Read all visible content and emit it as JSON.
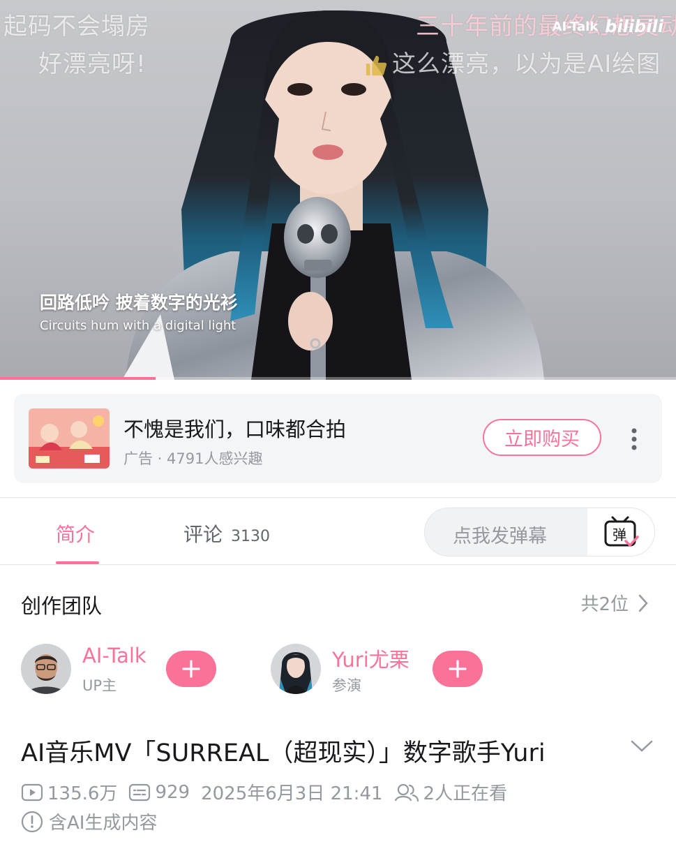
{
  "video": {
    "danmaku": [
      "起码不会塌房",
      "好漂亮呀!",
      "三十年前的最终幻想灵动",
      "这么漂亮，以为是AI绘图"
    ],
    "watermark_channel": "AI-Talk",
    "watermark_logo": "bilibili",
    "subtitle_cn": "回路低吟 披着数字的光衫",
    "subtitle_en": "Circuits hum with a digital light",
    "progress_fraction": 0.23
  },
  "ad": {
    "title": "不愧是我们，口味都合拍",
    "meta": "广告 · 4791人感兴趣",
    "buy_label": "立即购买"
  },
  "tabs": {
    "intro_label": "简介",
    "comments_label": "评论",
    "comments_count": "3130",
    "danmaku_placeholder": "点我发弹幕",
    "danmaku_toggle_char": "弹"
  },
  "creators": {
    "section_title": "创作团队",
    "count_label": "共2位",
    "items": [
      {
        "name": "AI-Talk",
        "role": "UP主"
      },
      {
        "name": "Yuri尤栗",
        "role": "参演"
      }
    ]
  },
  "video_info": {
    "title": "AI音乐MV「SURREAL（超现实）」数字歌手Yuri",
    "views": "135.6万",
    "danmaku_count": "929",
    "publish_time": "2025年6月3日 21:41",
    "watching": "2人正在看",
    "aigc_notice": "含AI生成内容"
  },
  "colors": {
    "accent": "#fb7299",
    "text_primary": "#18191c",
    "text_secondary": "#9499a0",
    "card_bg": "#f4f5f7"
  }
}
